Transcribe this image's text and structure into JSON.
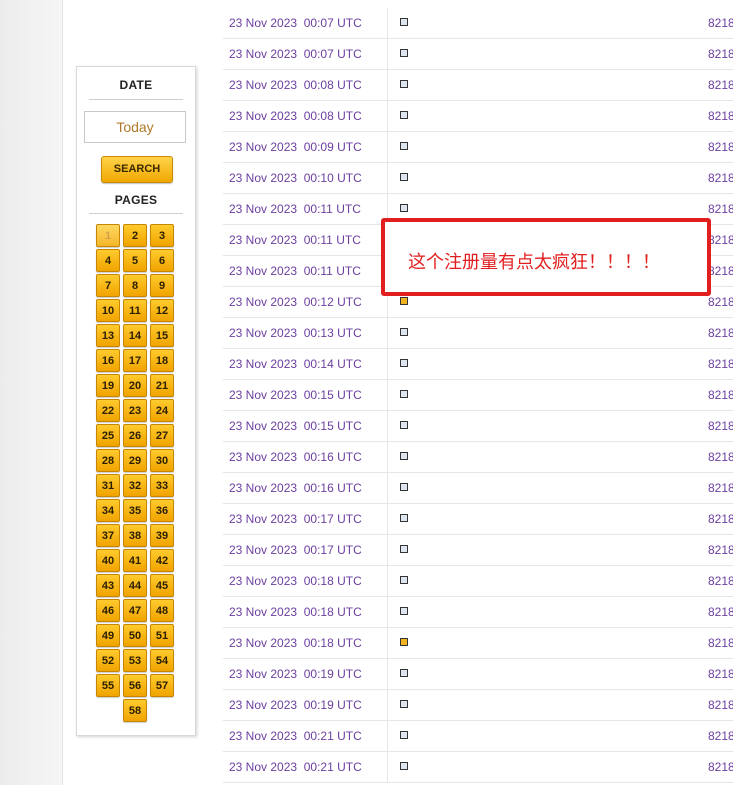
{
  "sidebar": {
    "date_heading": "DATE",
    "date_value": "Today",
    "search_label": "SEARCH",
    "pages_heading": "PAGES",
    "pages": [
      "1",
      "2",
      "3",
      "4",
      "5",
      "6",
      "7",
      "8",
      "9",
      "10",
      "11",
      "12",
      "13",
      "14",
      "15",
      "16",
      "17",
      "18",
      "19",
      "20",
      "21",
      "22",
      "23",
      "24",
      "25",
      "26",
      "27",
      "28",
      "29",
      "30",
      "31",
      "32",
      "33",
      "34",
      "35",
      "36",
      "37",
      "38",
      "39",
      "40",
      "41",
      "42",
      "43",
      "44",
      "45",
      "46",
      "47",
      "48",
      "49",
      "50",
      "51",
      "52",
      "53",
      "54",
      "55",
      "56",
      "57",
      "58"
    ],
    "current_page": "1"
  },
  "rows": [
    {
      "date": "23 Nov 2023  00:07 UTC",
      "flag": "gray",
      "num": "8218"
    },
    {
      "date": "23 Nov 2023  00:07 UTC",
      "flag": "gray",
      "num": "8218"
    },
    {
      "date": "23 Nov 2023  00:08 UTC",
      "flag": "gray",
      "num": "8218"
    },
    {
      "date": "23 Nov 2023  00:08 UTC",
      "flag": "gray",
      "num": "8218"
    },
    {
      "date": "23 Nov 2023  00:09 UTC",
      "flag": "gray",
      "num": "8218"
    },
    {
      "date": "23 Nov 2023  00:10 UTC",
      "flag": "gray",
      "num": "8218"
    },
    {
      "date": "23 Nov 2023  00:11 UTC",
      "flag": "gray",
      "num": "8218"
    },
    {
      "date": "23 Nov 2023  00:11 UTC",
      "flag": "gray",
      "num": "8218"
    },
    {
      "date": "23 Nov 2023  00:11 UTC",
      "flag": "gray",
      "num": "8218"
    },
    {
      "date": "23 Nov 2023  00:12 UTC",
      "flag": "yellow",
      "num": "8218"
    },
    {
      "date": "23 Nov 2023  00:13 UTC",
      "flag": "gray",
      "num": "8218"
    },
    {
      "date": "23 Nov 2023  00:14 UTC",
      "flag": "gray",
      "num": "8218"
    },
    {
      "date": "23 Nov 2023  00:15 UTC",
      "flag": "gray",
      "num": "8218"
    },
    {
      "date": "23 Nov 2023  00:15 UTC",
      "flag": "gray",
      "num": "8218"
    },
    {
      "date": "23 Nov 2023  00:16 UTC",
      "flag": "gray",
      "num": "8218"
    },
    {
      "date": "23 Nov 2023  00:16 UTC",
      "flag": "gray",
      "num": "8218"
    },
    {
      "date": "23 Nov 2023  00:17 UTC",
      "flag": "gray",
      "num": "8218"
    },
    {
      "date": "23 Nov 2023  00:17 UTC",
      "flag": "gray",
      "num": "8218"
    },
    {
      "date": "23 Nov 2023  00:18 UTC",
      "flag": "gray",
      "num": "8218"
    },
    {
      "date": "23 Nov 2023  00:18 UTC",
      "flag": "gray",
      "num": "8218"
    },
    {
      "date": "23 Nov 2023  00:18 UTC",
      "flag": "yellow",
      "num": "8218"
    },
    {
      "date": "23 Nov 2023  00:19 UTC",
      "flag": "gray",
      "num": "8218"
    },
    {
      "date": "23 Nov 2023  00:19 UTC",
      "flag": "gray",
      "num": "8218"
    },
    {
      "date": "23 Nov 2023  00:21 UTC",
      "flag": "gray",
      "num": "8218"
    },
    {
      "date": "23 Nov 2023  00:21 UTC",
      "flag": "gray",
      "num": "8218"
    }
  ],
  "annotation": {
    "text": "这个注册量有点太疯狂！！！！",
    "color": "#e21f1f"
  },
  "colors": {
    "accent_yellow": "#f2b322",
    "link_purple": "#6b3fa0"
  }
}
